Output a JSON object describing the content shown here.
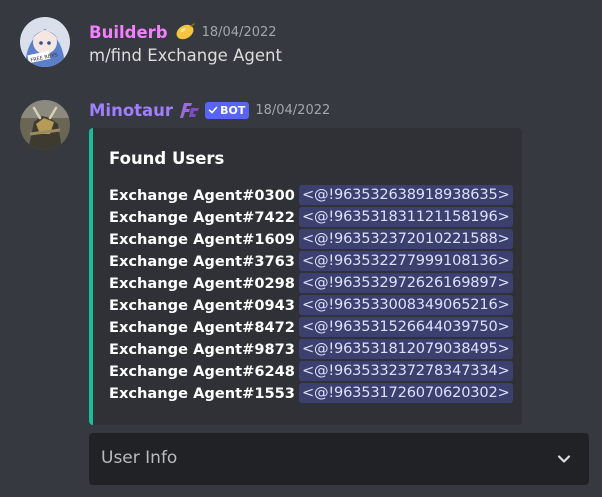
{
  "messages": [
    {
      "username": "Builderb",
      "username_color": "#f47fff",
      "timestamp": "18/04/2022",
      "badge_icon": "lemon-icon",
      "content": "m/find Exchange Agent"
    },
    {
      "username": "Minotaur",
      "username_color": "#a07fff",
      "timestamp": "18/04/2022",
      "badge_icon": "team-logo-icon",
      "bot_tag": "BOT",
      "embed": {
        "accent_color": "#1abc9c",
        "title": "Found Users",
        "users": [
          {
            "name": "Exchange Agent#0300",
            "mention": "<@!963532638918938635>"
          },
          {
            "name": "Exchange Agent#7422",
            "mention": "<@!963531831121158196>"
          },
          {
            "name": "Exchange Agent#1609",
            "mention": "<@!963532372010221588>"
          },
          {
            "name": "Exchange Agent#3763",
            "mention": "<@!963532277999108136>"
          },
          {
            "name": "Exchange Agent#0298",
            "mention": "<@!963532972626169897>"
          },
          {
            "name": "Exchange Agent#0943",
            "mention": "<@!963533008349065216>"
          },
          {
            "name": "Exchange Agent#8472",
            "mention": "<@!963531526644039750>"
          },
          {
            "name": "Exchange Agent#9873",
            "mention": "<@!963531812079038495>"
          },
          {
            "name": "Exchange Agent#6248",
            "mention": "<@!963533237278347334>"
          },
          {
            "name": "Exchange Agent#1553",
            "mention": "<@!963531726070620302>"
          }
        ]
      },
      "select_menu": {
        "placeholder": "User Info",
        "icon": "chevron-down-icon"
      }
    }
  ],
  "colors": {
    "background": "#36393f",
    "embed_background": "#2f3136",
    "select_background": "#202225",
    "mention_text": "#dee0fc",
    "bot_tag": "#5865f2"
  }
}
